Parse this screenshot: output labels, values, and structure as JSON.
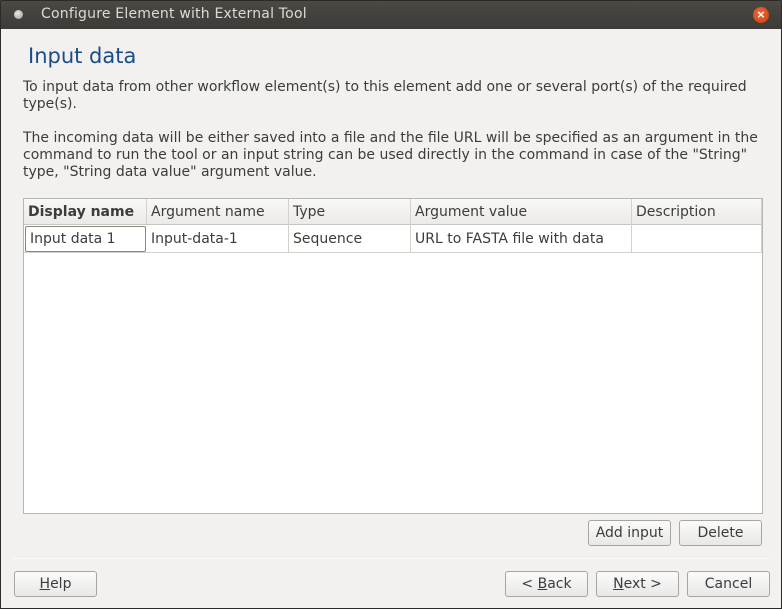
{
  "window": {
    "title": "Configure Element with External Tool",
    "close_glyph": "×"
  },
  "page": {
    "heading": "Input data",
    "description_1": "To input data from other workflow element(s) to this element add one or several port(s) of the required type(s).",
    "description_2": "The incoming data will be either saved into a file and the file URL will be specified as an argument in the command to run the tool or an input string can be used directly in the command in case of the \"String\" type, \"String data value\" argument value."
  },
  "table": {
    "columns": [
      "Display name",
      "Argument name",
      "Type",
      "Argument value",
      "Description"
    ],
    "rows": [
      {
        "display_name": "Input data 1",
        "argument_name": "Input-data-1",
        "type": "Sequence",
        "argument_value": "URL to FASTA file with data",
        "description": ""
      }
    ]
  },
  "actions": {
    "add_input": "Add input",
    "delete": "Delete"
  },
  "footer": {
    "help_mnemonic": "H",
    "help_rest": "elp",
    "back_prefix": "< ",
    "back_mnemonic": "B",
    "back_rest": "ack",
    "next_mnemonic": "N",
    "next_rest": "ext >",
    "cancel": "Cancel"
  },
  "colors": {
    "heading": "#1a4c85",
    "titlebar": "#3c3b37",
    "close_button": "#e0532a"
  }
}
